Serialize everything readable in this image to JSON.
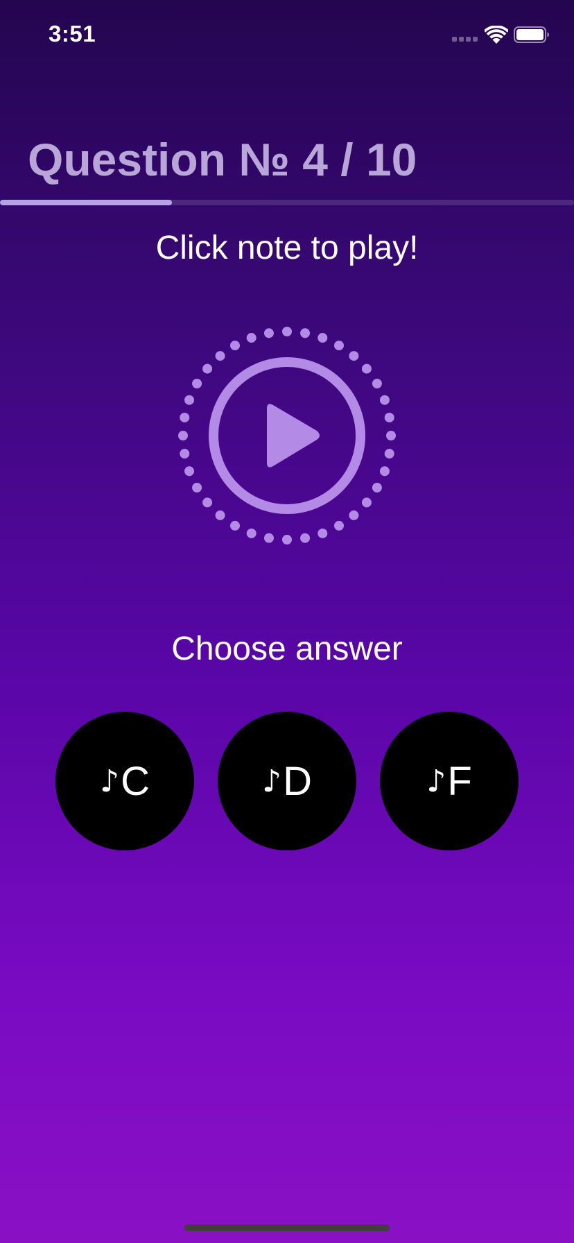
{
  "status_bar": {
    "time": "3:51"
  },
  "quiz": {
    "title": "Question № 4 / 10",
    "progress_fraction": 0.3,
    "instruction": "Click note to play!",
    "choose_label": "Choose answer"
  },
  "answers": [
    {
      "glyph": "♪",
      "label": "C"
    },
    {
      "glyph": "♪",
      "label": "D"
    },
    {
      "glyph": "♪",
      "label": "F"
    }
  ],
  "colors": {
    "background_top": "#240550",
    "background_bottom": "#8a10c4",
    "title_color": "#b9a6d9",
    "accent": "#b7a2e6",
    "answer_button": "#000000"
  },
  "icons": {
    "play": "play-icon",
    "wifi": "wifi-icon",
    "battery": "battery-icon",
    "signal": "signal-icon",
    "note": "music-note-icon"
  }
}
